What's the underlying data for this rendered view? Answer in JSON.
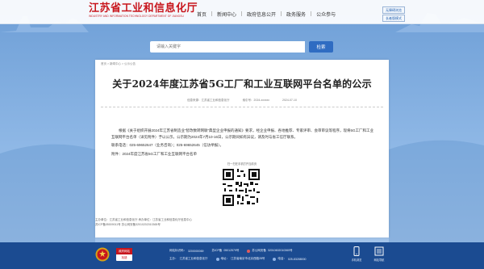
{
  "header": {
    "logo_title": "江苏省工业和信息化厅",
    "logo_subtitle": "INDUSTRY AND INFORMATION TECHNOLOGY DEPARTMENT OF JIANGSU",
    "nav": [
      "首页",
      "新闻中心",
      "政府信息公开",
      "政务服务",
      "公众参与"
    ],
    "top_links": [
      "无障碍浏览",
      "长者版模式"
    ]
  },
  "search": {
    "placeholder": "请输入关键字",
    "button_label": "检索"
  },
  "article": {
    "breadcrumb": "首页 > 新闻中心 > 公示公告",
    "title": "关于2024年度江苏省5G工厂和工业互联网平台名单的公示",
    "source": "信息来源：江苏省工业和信息化厅",
    "doc_number": "索引号：2024-xxxxxx",
    "date": "2024-07-10",
    "para1": "根据《关于组织开展2024年江苏省制造业“智改数转网联”典型企业申报的通知》要求，经企业申报、各地推荐、专家评审、会审审议等程序，现将5G工厂和工业互联网平台名单（详见附件）予以公示。公示期为2024年7月10-16日，公示期间如有异议，请及时与省工信厅联系。",
    "para2": "联系电话：025-69652647（业务咨询）；025-69652645（信访举报）。",
    "attachment": "附件：2024年度江苏省5G工厂和工业互联网平台名单",
    "qr_label": "扫一扫在手机打开当前页"
  },
  "footer": {
    "info_lines": [
      "主办单位：江苏省工业和信息化厅  承办单位：江苏省工业和信息化厅信息中心",
      "苏ICP备05009011号  苏公网安备32010202010365号"
    ],
    "gov_badge_top": "政府网站",
    "gov_badge_bottom": "找错",
    "line1": [
      {
        "label": "网站标识码：",
        "value": "3200000069"
      },
      {
        "label": "苏ICP备",
        "value": "05012579号"
      },
      {
        "label": "苏公网安备",
        "value": "32010602010365号"
      }
    ],
    "line2": [
      {
        "label": "主办：",
        "value": "江苏省工业和信息化厅"
      },
      {
        "label": "地址：",
        "value": "江苏省南京市北京西路28号"
      },
      {
        "label": "电话：",
        "value": "025-83288000"
      }
    ],
    "mobile_label": "手机浏览",
    "app_label": "网站导航"
  },
  "colors": {
    "brand_red": "#c8161d",
    "accent_blue": "#2f6cc2",
    "footer_blue": "#1b4b91"
  }
}
